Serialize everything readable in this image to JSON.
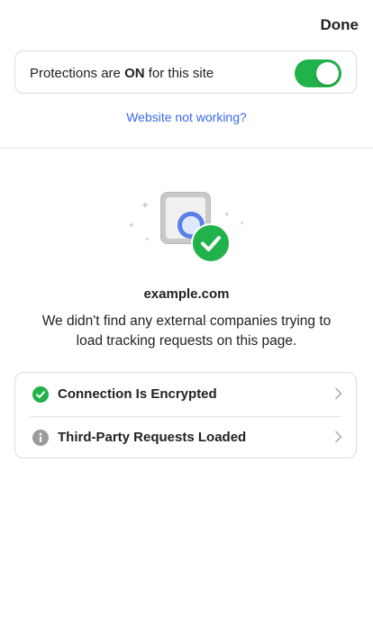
{
  "header": {
    "done_label": "Done"
  },
  "protection": {
    "text_prefix": "Protections are ",
    "status": "ON",
    "text_suffix": " for this site",
    "enabled": true,
    "toggle_color": "#22b24c"
  },
  "link": {
    "website_not_working": "Website not working?"
  },
  "site": {
    "domain": "example.com",
    "message": "We didn't find any external companies trying to load tracking requests on this page."
  },
  "details": [
    {
      "label": "Connection Is Encrypted",
      "icon": "green-check-icon",
      "icon_color": "#21b24b"
    },
    {
      "label": "Third-Party Requests Loaded",
      "icon": "info-icon",
      "icon_color": "#9b9b9b"
    }
  ],
  "colors": {
    "accent_link": "#3969ef",
    "success": "#21b24b",
    "shield_blue": "#5b7fe8"
  }
}
